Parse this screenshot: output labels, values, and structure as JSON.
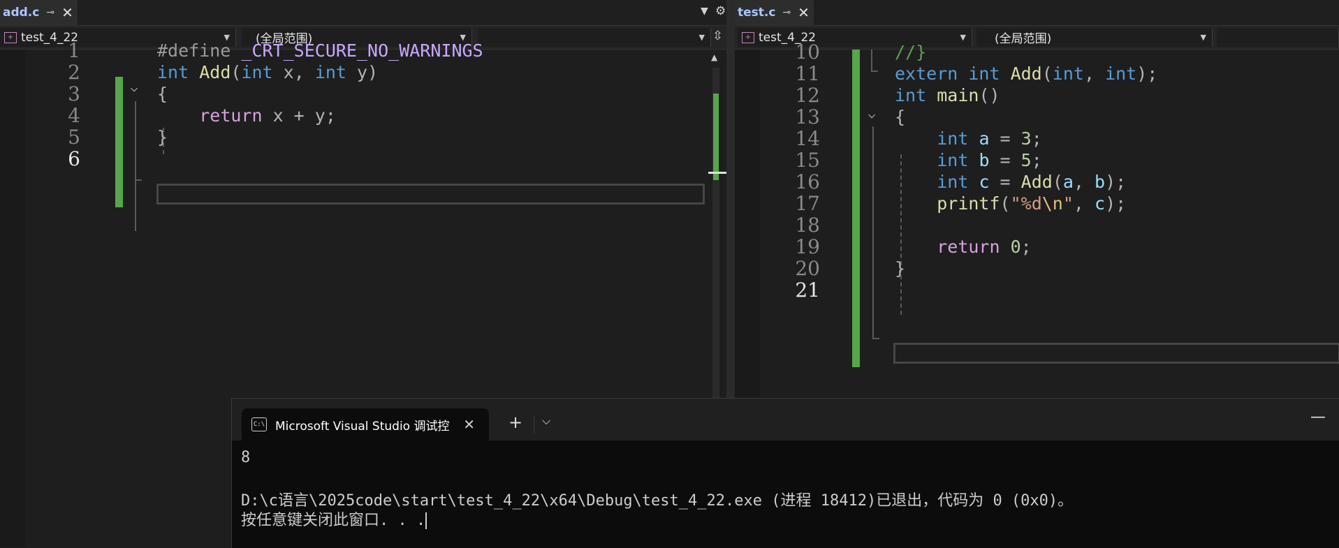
{
  "left": {
    "tab": {
      "title": "add.c"
    },
    "nav": {
      "project": "test_4_22",
      "scope": "(全局范围)",
      "member": ""
    },
    "lines": [
      {
        "num": "1",
        "tokens": [
          [
            "pp",
            "#define "
          ],
          [
            "mac",
            "_CRT_SECURE_NO_WARNINGS"
          ]
        ]
      },
      {
        "num": "2",
        "tokens": [
          [
            "kw",
            "int "
          ],
          [
            "fn",
            "Add"
          ],
          [
            "op",
            "("
          ],
          [
            "kw",
            "int "
          ],
          [
            "op",
            "x, "
          ],
          [
            "kw",
            "int "
          ],
          [
            "op",
            "y)"
          ]
        ]
      },
      {
        "num": "3",
        "tokens": [
          [
            "op",
            "{"
          ]
        ]
      },
      {
        "num": "4",
        "tokens": [
          [
            "op",
            "    "
          ],
          [
            "ctl",
            "return "
          ],
          [
            "op",
            "x + y;"
          ]
        ]
      },
      {
        "num": "5",
        "tokens": [
          [
            "op",
            "}"
          ]
        ]
      },
      {
        "num": "6",
        "tokens": []
      }
    ]
  },
  "right": {
    "tab": {
      "title": "test.c"
    },
    "nav": {
      "project": "test_4_22",
      "scope": "(全局范围)",
      "member": ""
    },
    "lines": [
      {
        "num": "10",
        "tokens": [
          [
            "cmt",
            "//}"
          ]
        ]
      },
      {
        "num": "11",
        "tokens": [
          [
            "kw",
            "extern "
          ],
          [
            "kw",
            "int "
          ],
          [
            "fn",
            "Add"
          ],
          [
            "op",
            "("
          ],
          [
            "kw",
            "int"
          ],
          [
            "op",
            ", "
          ],
          [
            "kw",
            "int"
          ],
          [
            "op",
            ");"
          ]
        ]
      },
      {
        "num": "12",
        "tokens": [
          [
            "kw",
            "int "
          ],
          [
            "fn",
            "main"
          ],
          [
            "op",
            "()"
          ]
        ]
      },
      {
        "num": "13",
        "tokens": [
          [
            "op",
            "{"
          ]
        ]
      },
      {
        "num": "14",
        "tokens": [
          [
            "op",
            "    "
          ],
          [
            "kw",
            "int "
          ],
          [
            "id",
            "a"
          ],
          [
            "op",
            " = "
          ],
          [
            "num",
            "3"
          ],
          [
            "op",
            ";"
          ]
        ]
      },
      {
        "num": "15",
        "tokens": [
          [
            "op",
            "    "
          ],
          [
            "kw",
            "int "
          ],
          [
            "id",
            "b"
          ],
          [
            "op",
            " = "
          ],
          [
            "num",
            "5"
          ],
          [
            "op",
            ";"
          ]
        ]
      },
      {
        "num": "16",
        "tokens": [
          [
            "op",
            "    "
          ],
          [
            "kw",
            "int "
          ],
          [
            "id",
            "c"
          ],
          [
            "op",
            " = "
          ],
          [
            "fn",
            "Add"
          ],
          [
            "op",
            "("
          ],
          [
            "id",
            "a"
          ],
          [
            "op",
            ", "
          ],
          [
            "id",
            "b"
          ],
          [
            "op",
            ");"
          ]
        ]
      },
      {
        "num": "17",
        "tokens": [
          [
            "op",
            "    "
          ],
          [
            "fn",
            "printf"
          ],
          [
            "op",
            "("
          ],
          [
            "str",
            "\"%d"
          ],
          [
            "esc",
            "\\n"
          ],
          [
            "str",
            "\""
          ],
          [
            "op",
            ", "
          ],
          [
            "id",
            "c"
          ],
          [
            "op",
            ");"
          ]
        ]
      },
      {
        "num": "18",
        "tokens": []
      },
      {
        "num": "19",
        "tokens": [
          [
            "op",
            "    "
          ],
          [
            "ctl",
            "return "
          ],
          [
            "num",
            "0"
          ],
          [
            "op",
            ";"
          ]
        ]
      },
      {
        "num": "20",
        "tokens": [
          [
            "op",
            "}"
          ]
        ]
      },
      {
        "num": "21",
        "tokens": []
      }
    ]
  },
  "console": {
    "tab_title": "Microsoft Visual Studio 调试控",
    "icon_text": "C:\\",
    "output": [
      "8",
      "",
      "D:\\c语言\\2025code\\start\\test_4_22\\x64\\Debug\\test_4_22.exe (进程 18412)已退出，代码为 0 (0x0)。",
      "按任意键关闭此窗口. . ."
    ]
  },
  "colors": {
    "change_bar": "#57a64a",
    "keyword": "#569cd6",
    "function": "#dcdcaa",
    "control": "#d8a0df",
    "comment": "#57a64a",
    "string": "#d69d85",
    "number": "#b5cea8",
    "identifier": "#9cdcfe"
  },
  "icons": {
    "tab_pin": "pin-icon",
    "tab_close": "close-icon",
    "dropdown": "chevron-down-icon",
    "settings": "gear-icon",
    "split": "split-icon",
    "fold": "collapse-chevron-icon"
  }
}
